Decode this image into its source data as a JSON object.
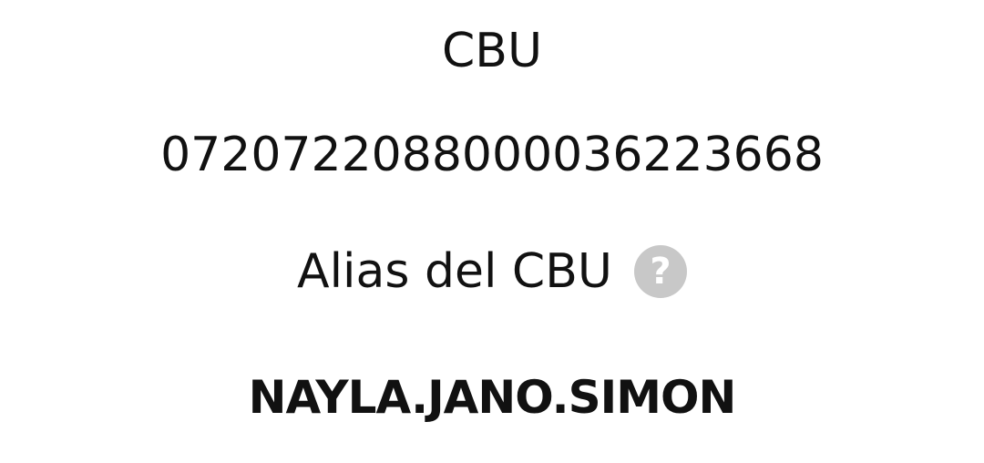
{
  "cbu": {
    "label": "CBU",
    "value": "0720722088000036223668"
  },
  "alias": {
    "label": "Alias del CBU",
    "help_icon": "question-circle-icon",
    "help_glyph": "?",
    "value": "NAYLA.JANO.SIMON"
  },
  "colors": {
    "text": "#111111",
    "help_icon_bg": "#c8c8c8",
    "background": "#ffffff"
  }
}
